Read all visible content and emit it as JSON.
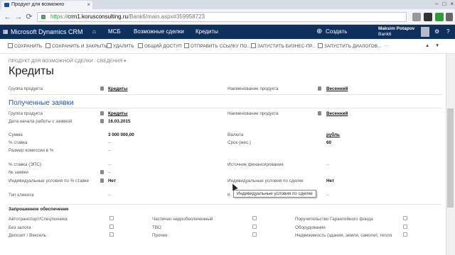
{
  "browser": {
    "tab_title": "Продукт для возможно",
    "tab_close": "×",
    "url_scheme": "https://",
    "url_host": "crm1.korusconsulting.ru",
    "url_path": "/Bank6/main.aspx#359958723",
    "nav_back": "←",
    "nav_forward": "→",
    "nav_reload": "⟳",
    "win_min": "–",
    "win_max": "□",
    "win_close": "×"
  },
  "crm": {
    "app_name": "Microsoft Dynamics CRM",
    "home_icon": "⌂",
    "crumb1": "МСБ",
    "crumb2": "Возможные сделки",
    "crumb3": "Кредиты",
    "create_label": "Создать",
    "user_name": "Maksim Potapov",
    "org": "Bank6",
    "help": "?",
    "settings": "⚙"
  },
  "toolbar": [
    {
      "label": "СОХРАНИТЬ"
    },
    {
      "label": "СОХРАНИТЬ И ЗАКРЫТЬ"
    },
    {
      "label": "УДАЛИТЬ"
    },
    {
      "label": "ОБЩИЙ ДОСТУП"
    },
    {
      "label": "ОТПРАВИТЬ ССЫЛКУ ПО..."
    },
    {
      "label": "ЗАПУСТИТЬ БИЗНЕС-ПР..."
    },
    {
      "label": "ЗАПУСТИТЬ ДИАЛОГОВ..."
    }
  ],
  "form": {
    "type_label": "ПРОДУКТ ДЛЯ ВОЗМОЖНОЙ СДЕЛКИ : СВЕДЕНИЯ",
    "title": "Кредиты",
    "group_label": "Группа продукта",
    "group_value": "Кредиты",
    "name_label": "Наименование продукта",
    "name_value": "Весенний",
    "section_title": "Полученные заявки",
    "f1_l": "Группа продукта",
    "f1_v": "Кредиты",
    "f2_l": "Наименование продукта",
    "f2_v": "Весенний",
    "f3_l": "Дата начала работы с заявкой",
    "f3_v": "16.03.2015",
    "f4_l": "Сумма",
    "f4_v": "3 000 000,00",
    "f5_l": "Валюта",
    "f5_v": "рубль",
    "f6_l": "% ставка",
    "f6_v": "--",
    "f7_l": "Срок (мес.)",
    "f7_v": "60",
    "f8_l": "Размер комиссии в %",
    "f8_v": "--",
    "f9_l": "% ставка (ЭПС)",
    "f9_v": "--",
    "f10_l": "Источник финансирования",
    "f10_v": "--",
    "f11_l": "№ заявки",
    "f11_v": "--",
    "f12_l": "Индивидуальные условия по % ставке",
    "f12_v": "Нет",
    "f13_l": "Индивидуальные условия по сделке",
    "f13_v": "Нет",
    "f14_l": "Тип клиента",
    "f14_v": "--",
    "f15_v": "--",
    "tooltip": "Индивидуальные условия по сделке",
    "collateral_title": "Запрошенное обеспечение",
    "c1": "Автотранспорт/Спецтехника",
    "c2": "Без залога",
    "c3": "Депозит / Вексель",
    "c4": "Частично недообеспеченный",
    "c5": "ТВО",
    "c6": "Прочее",
    "c7": "Поручительство Гарантийного фонда",
    "c8": "Оборудование",
    "c9": "Недвижимость (здания, земля, самолет, тепло"
  }
}
